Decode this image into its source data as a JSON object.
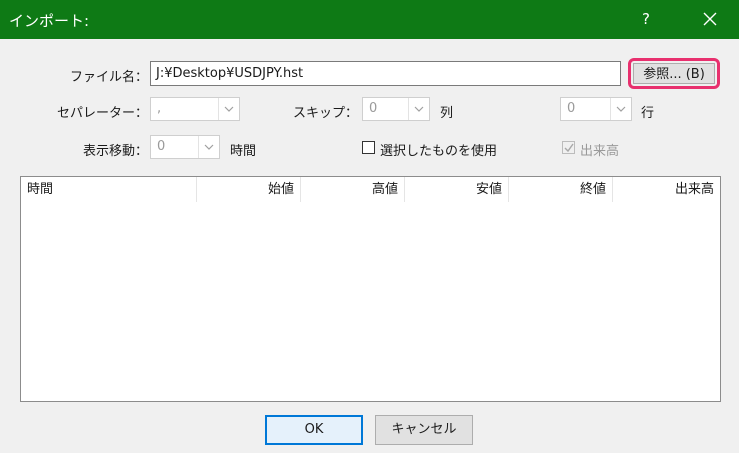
{
  "window": {
    "title": "インポート:",
    "help": "?",
    "close_icon": "close-icon"
  },
  "form": {
    "filename_label": "ファイル名：",
    "filename_value": "J:¥Desktop¥USDJPY.hst",
    "browse_label": "参照... (B)",
    "separator_label": "セパレーター：",
    "separator_value": ",",
    "skip_label": "スキップ：",
    "skip_col_value": "0",
    "col_unit": "列",
    "skip_row_value": "0",
    "row_unit": "行",
    "shift_label": "表示移動：",
    "shift_value": "0",
    "shift_unit": "時間",
    "use_selected_label": "選択したものを使用",
    "use_selected_checked": false,
    "volume_label": "出来高",
    "volume_checked": true
  },
  "table": {
    "columns": [
      "時間",
      "始値",
      "高値",
      "安値",
      "終値",
      "出来高"
    ],
    "rows": []
  },
  "footer": {
    "ok_label": "OK",
    "cancel_label": "キャンセル"
  },
  "colors": {
    "titlebar": "#0e7a15",
    "highlight": "#e8306e",
    "ok_border": "#0078d7"
  }
}
